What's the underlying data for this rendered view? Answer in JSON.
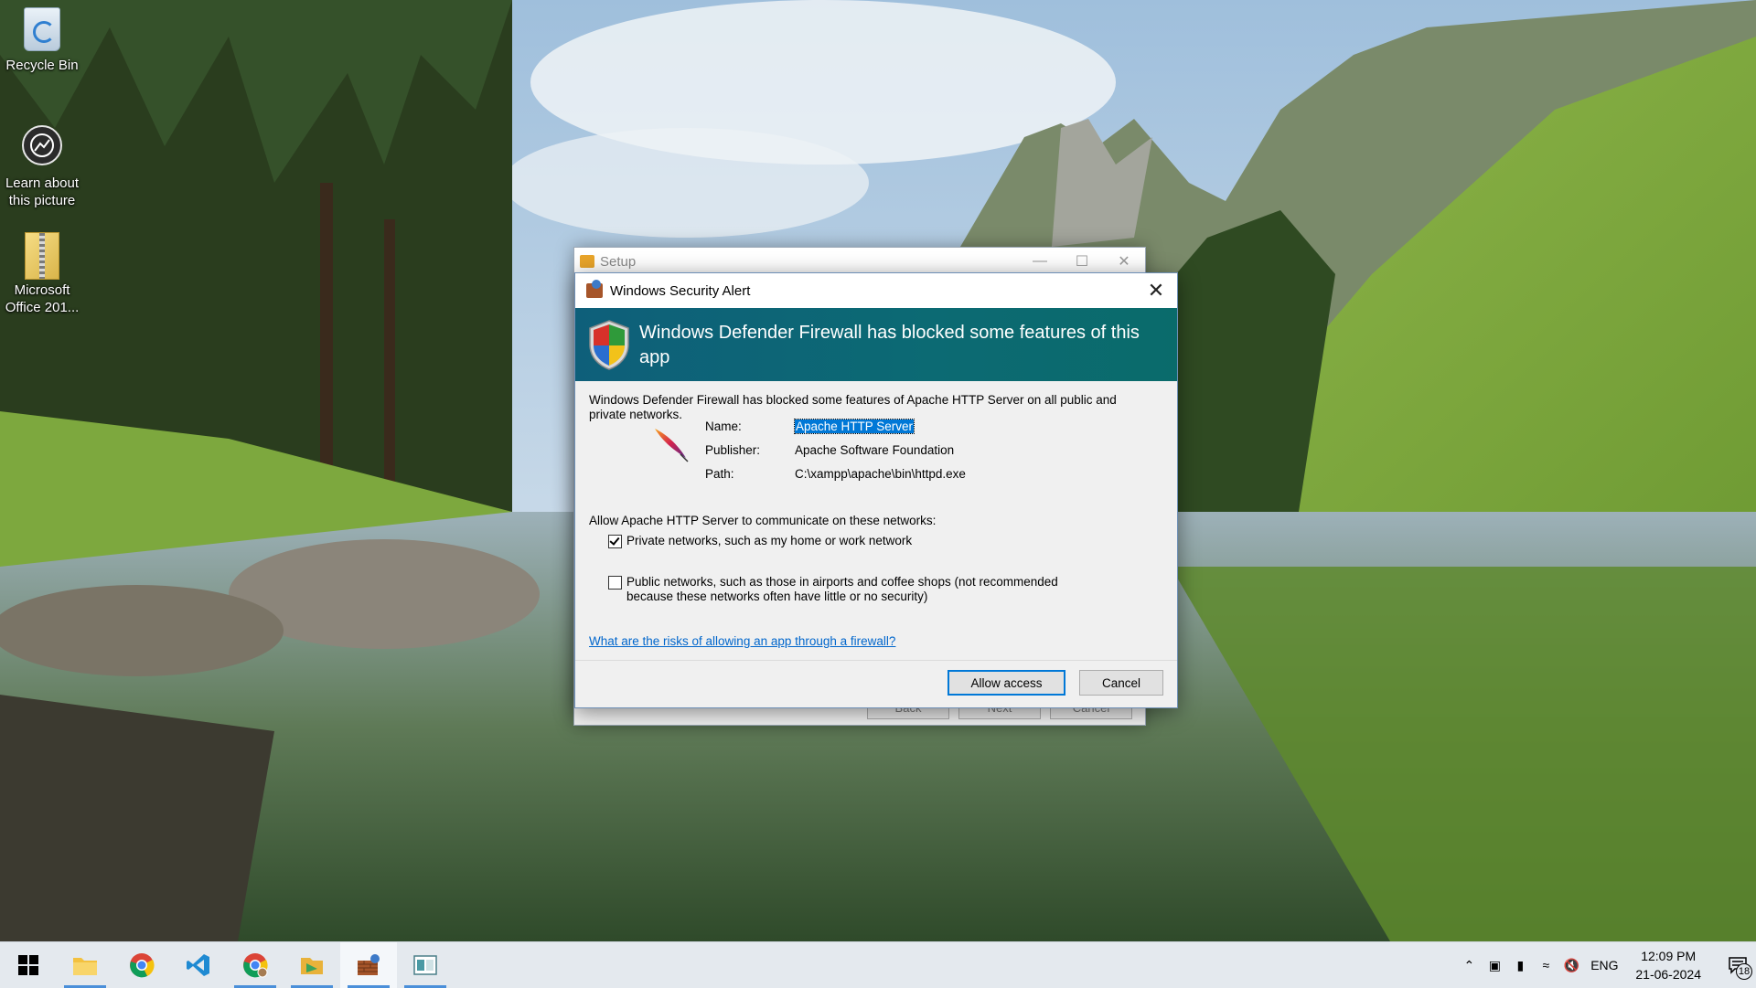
{
  "desktop": {
    "icons": [
      {
        "label": "Recycle Bin"
      },
      {
        "label": "Learn about this picture"
      },
      {
        "label": "Microsoft Office 201..."
      }
    ]
  },
  "setup_window": {
    "title": "Setup",
    "buttons": [
      "Back",
      "Next",
      "Cancel"
    ]
  },
  "alert": {
    "title": "Windows Security Alert",
    "heading": "Windows Defender Firewall has blocked some features of this app",
    "intro": "Windows Defender Firewall has blocked some features of Apache HTTP Server on all public and private networks.",
    "fields": [
      {
        "label": "Name:",
        "value": "Apache HTTP Server"
      },
      {
        "label": "Publisher:",
        "value": "Apache Software Foundation"
      },
      {
        "label": "Path:",
        "value": "C:\\xampp\\apache\\bin\\httpd.exe"
      }
    ],
    "allow_label": "Allow Apache HTTP Server to communicate on these networks:",
    "private_option": {
      "label": "Private networks, such as my home or work network",
      "checked": true
    },
    "public_option": {
      "label": "Public networks, such as those in airports and coffee shops (not recommended because these networks often have little or no security)",
      "checked": false
    },
    "risk_link": "What are the risks of allowing an app through a firewall?",
    "allow_button": "Allow access",
    "cancel_button": "Cancel",
    "banner_color": "#0d6274"
  },
  "taskbar": {
    "apps": [
      "start",
      "file-explorer",
      "chrome",
      "vscode",
      "chrome-profile",
      "setup-app",
      "security-alert",
      "terminal-app"
    ],
    "tray": {
      "language": "ENG",
      "time": "12:09 PM",
      "date": "21-06-2024",
      "notification_count": "18"
    }
  }
}
